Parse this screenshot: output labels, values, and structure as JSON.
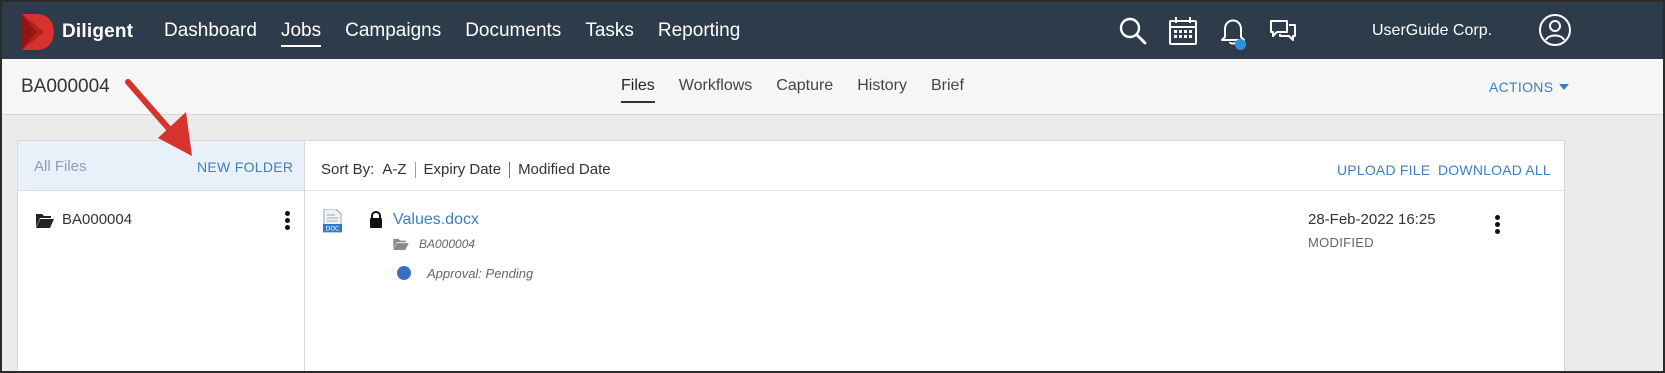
{
  "topnav": {
    "logo_text": "Diligent",
    "items": [
      {
        "label": "Dashboard",
        "active": false
      },
      {
        "label": "Jobs",
        "active": true
      },
      {
        "label": "Campaigns",
        "active": false
      },
      {
        "label": "Documents",
        "active": false
      },
      {
        "label": "Tasks",
        "active": false
      },
      {
        "label": "Reporting",
        "active": false
      }
    ],
    "icons": [
      "search-icon",
      "calendar-icon",
      "bell-icon",
      "chat-icon"
    ],
    "company": "UserGuide Corp.",
    "colors": {
      "bar": "#2e3b4b",
      "logo_red": "#d7322e",
      "notification": "#2f8fdc"
    }
  },
  "subheader": {
    "job_id": "BA000004",
    "tabs": [
      {
        "label": "Files",
        "active": true
      },
      {
        "label": "Workflows",
        "active": false
      },
      {
        "label": "Capture",
        "active": false
      },
      {
        "label": "History",
        "active": false
      },
      {
        "label": "Brief",
        "active": false
      }
    ],
    "actions_label": "ACTIONS"
  },
  "left_panel": {
    "all_files_label": "All Files",
    "new_folder_label": "NEW FOLDER",
    "folders": [
      {
        "name": "BA000004"
      }
    ]
  },
  "right_panel": {
    "sort_by_label": "Sort By:",
    "sort_options": [
      "A-Z",
      "Expiry Date",
      "Modified Date"
    ],
    "upload_label": "UPLOAD FILE",
    "download_label": "DOWNLOAD ALL",
    "files": [
      {
        "name": "Values.docx",
        "icon_text": "DOC",
        "folder": "BA000004",
        "status": "Approval: Pending",
        "date": "28-Feb-2022 16:25",
        "date_label": "MODIFIED"
      }
    ]
  },
  "colors": {
    "link": "#3d7fc4",
    "annotation_arrow": "#d7322e"
  }
}
